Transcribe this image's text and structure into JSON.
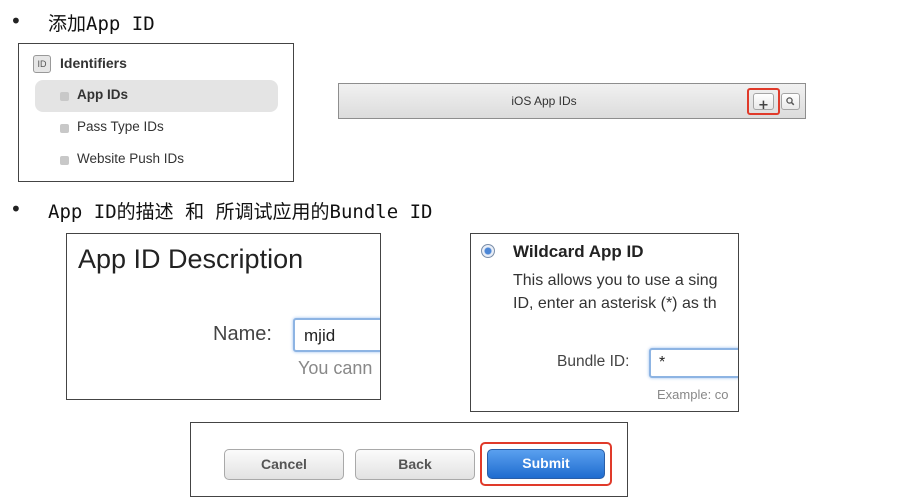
{
  "slide": {
    "bullets": [
      "•",
      "•"
    ],
    "heading_1": "添加App ID",
    "heading_2": "App ID的描述 和 所调试应用的Bundle ID"
  },
  "identifiers_panel": {
    "badge": "ID",
    "title": "Identifiers",
    "items": [
      {
        "label": "App IDs",
        "selected": true
      },
      {
        "label": "Pass Type IDs",
        "selected": false
      },
      {
        "label": "Website Push IDs",
        "selected": false
      }
    ]
  },
  "ios_bar": {
    "title": "iOS App IDs",
    "add_icon": "plus-icon",
    "add_symbol": "+",
    "search_icon": "search-icon",
    "highlight_color": "#e03a2a"
  },
  "description_panel": {
    "title": "App ID Description",
    "name_label": "Name:",
    "name_value": "mjid",
    "hint": "You cann"
  },
  "wildcard_panel": {
    "title": "Wildcard App ID",
    "line1": "This allows you to use a sing",
    "line2": "ID, enter an asterisk (*) as th",
    "bundle_label": "Bundle ID:",
    "bundle_value": "*",
    "example": "Example: co"
  },
  "buttons_panel": {
    "cancel": "Cancel",
    "back": "Back",
    "submit": "Submit",
    "primary_color": "#1f6ccf",
    "highlight_color": "#e03a2a"
  }
}
